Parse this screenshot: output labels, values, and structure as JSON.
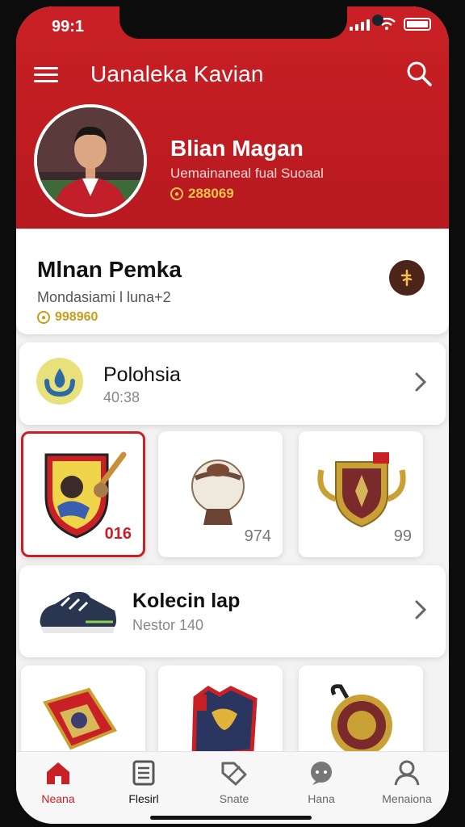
{
  "status_bar": {
    "time": "99:1"
  },
  "header": {
    "title": "Uanaleka Kavian"
  },
  "profile": {
    "name": "Blian Magan",
    "subtitle": "Uemainaneal fual Suoaal",
    "points": "288069"
  },
  "profile_card": {
    "name": "Mlnan Pemka",
    "subtitle": "Mondasiami l luna+2",
    "points": "998960"
  },
  "rows": [
    {
      "title": "Polohsia",
      "subtitle": "40:38",
      "icon": "water-drop-icon"
    },
    {
      "title": "Kolecin lap",
      "subtitle": "Nestor 140",
      "icon": "sneaker-icon"
    }
  ],
  "collection_row1": [
    {
      "name": "shield-crest",
      "count": "016",
      "selected": true
    },
    {
      "name": "ball-trophy",
      "count": "974",
      "selected": false
    },
    {
      "name": "cup-crest",
      "count": "99",
      "selected": false
    }
  ],
  "collection_row2": [
    {
      "name": "shield-badge",
      "count": ""
    },
    {
      "name": "jersey",
      "count": ""
    },
    {
      "name": "medal",
      "count": ""
    }
  ],
  "bottom_nav": [
    {
      "label": "Neana",
      "icon": "home-icon",
      "active": true
    },
    {
      "label": "Flesirl",
      "icon": "list-icon",
      "active": false
    },
    {
      "label": "Snate",
      "icon": "tag-icon",
      "active": false
    },
    {
      "label": "Hana",
      "icon": "chat-icon",
      "active": false
    },
    {
      "label": "Menaiona",
      "icon": "profile-icon",
      "active": false
    }
  ],
  "colors": {
    "accent": "#c92025",
    "gold": "#c69d1a",
    "background": "#f3f3f3"
  }
}
